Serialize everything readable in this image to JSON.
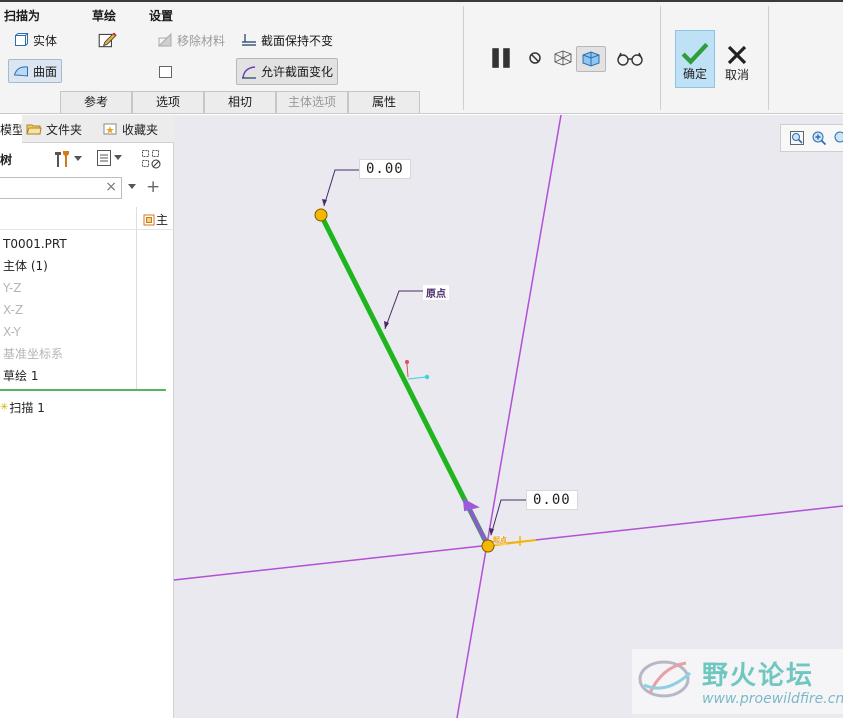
{
  "ribbon": {
    "groups": {
      "sweep_as": "扫描为",
      "sketch": "草绘",
      "settings": "设置"
    },
    "solid_label": "实体",
    "surface_label": "曲面",
    "remove_material_label": "移除材料",
    "keep_section_label": "截面保持不变",
    "allow_section_change_label": "允许截面变化",
    "tabs": [
      "参考",
      "选项",
      "相切",
      "主体选项",
      "属性"
    ],
    "ok_label": "确定",
    "cancel_label": "取消"
  },
  "left_panel": {
    "tabs": [
      "模型树",
      "文件夹",
      "收藏夹"
    ],
    "tree_label": "树",
    "search_placeholder": "",
    "column_header": "主",
    "tree": [
      {
        "label": "T0001.PRT",
        "state": "normal"
      },
      {
        "label": "主体 (1)",
        "state": "normal"
      },
      {
        "label": "Y-Z",
        "state": "gray"
      },
      {
        "label": "X-Z",
        "state": "gray"
      },
      {
        "label": "X-Y",
        "state": "gray"
      },
      {
        "label": "基准坐标系",
        "state": "gray"
      },
      {
        "label": "草绘 1",
        "state": "normal"
      },
      {
        "label": "扫描 1",
        "state": "new"
      }
    ]
  },
  "graphics": {
    "dim_top": "0.00",
    "dim_bottom": "0.00",
    "note_origin": "原点",
    "note_start": "起点"
  },
  "watermark": {
    "title": "野火论坛",
    "url": "www.proewildfire.cn"
  },
  "colors": {
    "trajectory": "#1fb51f",
    "datum": "#b44fd6",
    "endpoint": "#f5b800",
    "confirm_bg": "#bfe1f5",
    "confirm_check": "#2e9e3c"
  }
}
